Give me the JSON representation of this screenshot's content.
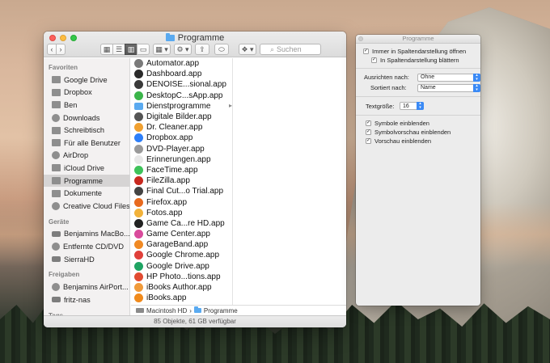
{
  "finder": {
    "title": "Programme",
    "toolbar": {
      "back": "‹",
      "forward": "›",
      "view_icon": "▦",
      "view_list": "☰",
      "view_column": "▥",
      "view_cover": "▭",
      "arrange": "▦ ▾",
      "action": "⚙ ▾",
      "share": "⇪",
      "tag": "⬭",
      "dropbox": "❖ ▾",
      "search_placeholder": "Suchen"
    },
    "sidebar": {
      "sections": [
        {
          "header": "Favoriten",
          "items": [
            {
              "label": "Google Drive",
              "icon": "folder-icon"
            },
            {
              "label": "Dropbox",
              "icon": "dropbox-icon"
            },
            {
              "label": "Ben",
              "icon": "home-icon"
            },
            {
              "label": "Downloads",
              "icon": "downloads-icon"
            },
            {
              "label": "Schreibtisch",
              "icon": "desktop-icon"
            },
            {
              "label": "Für alle Benutzer",
              "icon": "folder-icon"
            },
            {
              "label": "AirDrop",
              "icon": "airdrop-icon"
            },
            {
              "label": "iCloud Drive",
              "icon": "cloud-icon"
            },
            {
              "label": "Programme",
              "icon": "applications-icon",
              "selected": true
            },
            {
              "label": "Dokumente",
              "icon": "documents-icon"
            },
            {
              "label": "Creative Cloud Files",
              "icon": "creative-cloud-icon"
            }
          ]
        },
        {
          "header": "Geräte",
          "items": [
            {
              "label": "Benjamins MacBo...",
              "icon": "laptop-icon"
            },
            {
              "label": "Entfernte CD/DVD",
              "icon": "disc-icon"
            },
            {
              "label": "SierraHD",
              "icon": "disk-icon"
            }
          ]
        },
        {
          "header": "Freigaben",
          "items": [
            {
              "label": "Benjamins AirPort...",
              "icon": "airport-icon"
            },
            {
              "label": "fritz-nas",
              "icon": "server-icon"
            }
          ]
        },
        {
          "header": "Tags",
          "items": []
        }
      ]
    },
    "files": [
      {
        "name": "Automator.app",
        "color": "#7a7a7a"
      },
      {
        "name": "Dashboard.app",
        "color": "#2b2b2b"
      },
      {
        "name": "DENOISE...sional.app",
        "color": "#3a3a3a"
      },
      {
        "name": "DesktopC...sApp.app",
        "color": "#3bb54a"
      },
      {
        "name": "Dienstprogramme",
        "color": "#5aaaf0",
        "folder": true
      },
      {
        "name": "Digitale Bilder.app",
        "color": "#555555"
      },
      {
        "name": "Dr. Cleaner.app",
        "color": "#f0a030"
      },
      {
        "name": "Dropbox.app",
        "color": "#2d7ff9"
      },
      {
        "name": "DVD-Player.app",
        "color": "#9a9a9a"
      },
      {
        "name": "Erinnerungen.app",
        "color": "#e8e8e8"
      },
      {
        "name": "FaceTime.app",
        "color": "#3ec25a"
      },
      {
        "name": "FileZilla.app",
        "color": "#c8291f"
      },
      {
        "name": "Final Cut...o Trial.app",
        "color": "#444444"
      },
      {
        "name": "Firefox.app",
        "color": "#e86a1e"
      },
      {
        "name": "Fotos.app",
        "color": "#f2b23a"
      },
      {
        "name": "Game Ca...re HD.app",
        "color": "#222222"
      },
      {
        "name": "Game Center.app",
        "color": "#d94b9c"
      },
      {
        "name": "GarageBand.app",
        "color": "#f08a24"
      },
      {
        "name": "Google Chrome.app",
        "color": "#e0403a"
      },
      {
        "name": "Google Drive.app",
        "color": "#1fa463"
      },
      {
        "name": "HP Photo...tions.app",
        "color": "#e14c32"
      },
      {
        "name": "iBooks Author.app",
        "color": "#f09a3a"
      },
      {
        "name": "iBooks.app",
        "color": "#f08a1c"
      }
    ],
    "pathbar": {
      "disk": "Macintosh HD",
      "separator": "›",
      "folder": "Programme"
    },
    "status": "85 Objekte, 61 GB verfügbar"
  },
  "panel": {
    "title": "Programme",
    "always_open_label": "Immer in Spaltendarstellung öffnen",
    "browse_label": "In Spaltendarstellung blättern",
    "arrange_label": "Ausrichten nach:",
    "arrange_value": "Ohne",
    "sort_label": "Sortiert nach:",
    "sort_value": "Name",
    "textsize_label": "Textgröße:",
    "textsize_value": "16",
    "show_icons_label": "Symbole einblenden",
    "show_preview_icon_label": "Symbolvorschau einblenden",
    "show_preview_label": "Vorschau einblenden",
    "check": "✓"
  }
}
